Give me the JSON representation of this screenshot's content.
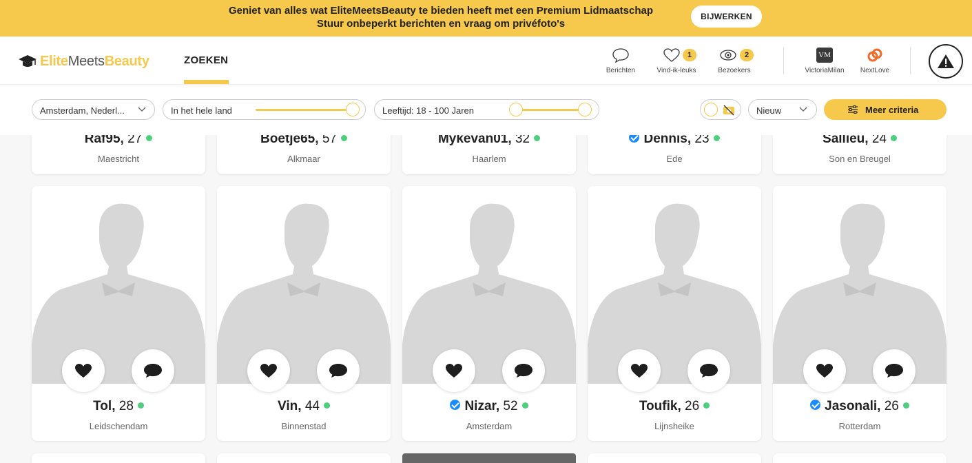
{
  "banner": {
    "line1": "Geniet van alles wat EliteMeetsBeauty te bieden heeft met een Premium Lidmaatschap",
    "line2": "Stuur onbeperkt berichten en vraag om privéfoto's",
    "button": "BIJWERKEN"
  },
  "header": {
    "logo": {
      "part1": "Elite",
      "part2": "Meets",
      "part3": "Beauty"
    },
    "search_tab": "ZOEKEN",
    "nav": {
      "messages": {
        "label": "Berichten",
        "icon": "chat-bubble-icon"
      },
      "likes": {
        "label": "Vind-ik-leuks",
        "badge": "1",
        "icon": "heart-icon"
      },
      "visitors": {
        "label": "Bezoekers",
        "badge": "2",
        "icon": "eye-icon"
      },
      "victoria": {
        "label": "VictoriaMilan",
        "mark": "VM"
      },
      "nextlove": {
        "label": "NextLove"
      }
    }
  },
  "filters": {
    "location": "Amsterdam, Nederl...",
    "distance": "In het hele land",
    "age": "Leeftijd: 18 - 100 Jaren",
    "sort": "Nieuw",
    "more": "Meer criteria"
  },
  "top_row": [
    {
      "name": "Raf95,",
      "age": "27",
      "city": "Maestricht",
      "verified": false
    },
    {
      "name": "Boetje65,",
      "age": "57",
      "city": "Alkmaar",
      "verified": false
    },
    {
      "name": "Mykevan01,",
      "age": "32",
      "city": "Haarlem",
      "verified": false
    },
    {
      "name": "Dennis,",
      "age": "23",
      "city": "Ede",
      "verified": true
    },
    {
      "name": "Sallieu,",
      "age": "24",
      "city": "Son en Breugel",
      "verified": false
    }
  ],
  "main_row": [
    {
      "name": "Tol,",
      "age": "28",
      "city": "Leidschendam",
      "verified": false
    },
    {
      "name": "Vin,",
      "age": "44",
      "city": "Binnenstad",
      "verified": false
    },
    {
      "name": "Nizar,",
      "age": "52",
      "city": "Amsterdam",
      "verified": true
    },
    {
      "name": "Toufik,",
      "age": "26",
      "city": "Lijnsheike",
      "verified": false
    },
    {
      "name": "Jasonali,",
      "age": "26",
      "city": "Rotterdam",
      "verified": true
    }
  ],
  "colors": {
    "accent": "#f6c84b",
    "online": "#4cd07d",
    "verified": "#1a8cff"
  }
}
